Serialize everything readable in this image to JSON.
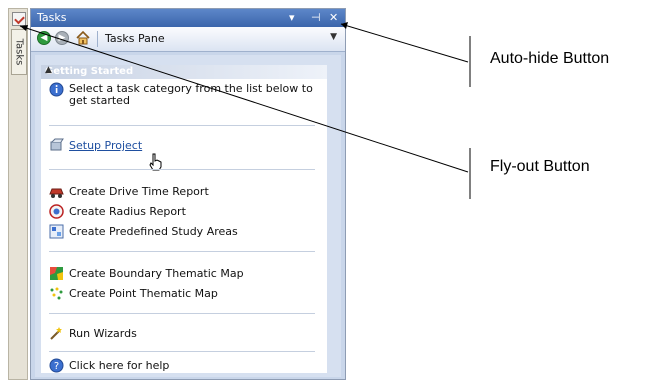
{
  "tabstrip": {
    "tab_label": "Tasks"
  },
  "pane": {
    "title": "Tasks",
    "title_buttons": {
      "menu": "▾",
      "pin": "⊣",
      "close": "✕"
    },
    "toolbar": {
      "pane_name": "Tasks Pane"
    },
    "section": {
      "header": "Getting Started",
      "intro": "Select a task category from the list below to get started",
      "setup": "Setup Project",
      "group1": [
        "Create Drive Time Report",
        "Create Radius Report",
        "Create Predefined Study Areas"
      ],
      "group2": [
        "Create Boundary Thematic Map",
        "Create Point Thematic Map"
      ],
      "wizards": "Run Wizards",
      "help": "Click here for help"
    }
  },
  "callouts": {
    "auto_hide": "Auto-hide Button",
    "fly_out": "Fly-out Button"
  },
  "colors": {
    "title_bar": "#4a76bd",
    "link": "#1f4fa0",
    "pane_bg": "#d6e0f0"
  }
}
